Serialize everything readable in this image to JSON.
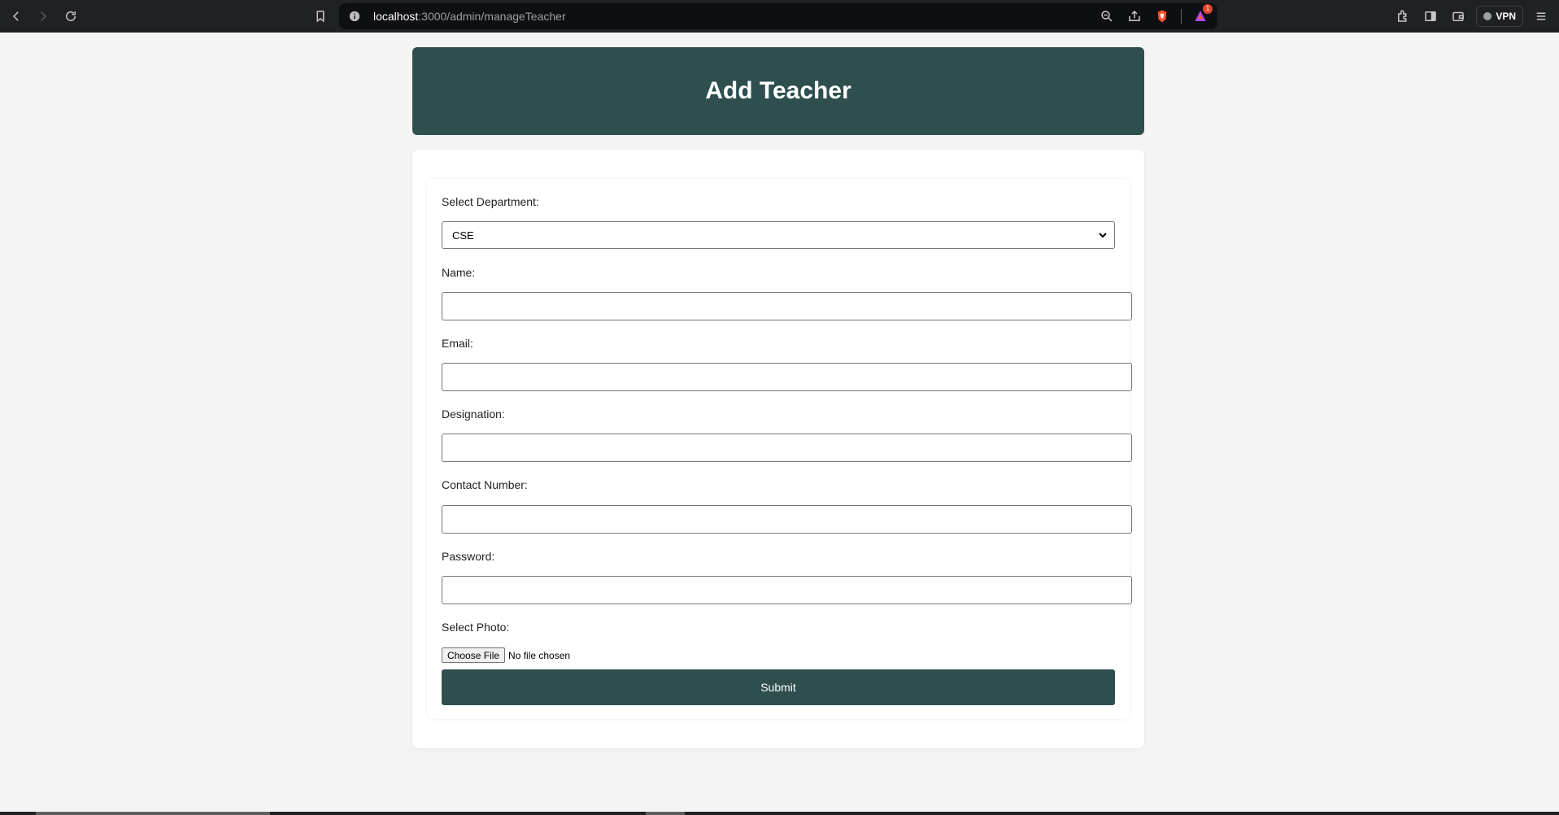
{
  "browser": {
    "url_host": "localhost",
    "url_path": ":3000/admin/manageTeacher",
    "vpn_label": "VPN",
    "rewards_badge_count": "1"
  },
  "page": {
    "title": "Add Teacher"
  },
  "form": {
    "department_label": "Select Department:",
    "department_value": "CSE",
    "name_label": "Name:",
    "name_value": "",
    "email_label": "Email:",
    "email_value": "",
    "designation_label": "Designation:",
    "designation_value": "",
    "contact_label": "Contact Number:",
    "contact_value": "",
    "password_label": "Password:",
    "password_value": "",
    "photo_label": "Select Photo:",
    "file_button_label": "Choose File",
    "file_status": "No file chosen",
    "submit_label": "Submit"
  },
  "colors": {
    "accent": "#2f4f4f",
    "page_bg": "#f4f4f4",
    "chrome_bg": "#202124"
  }
}
